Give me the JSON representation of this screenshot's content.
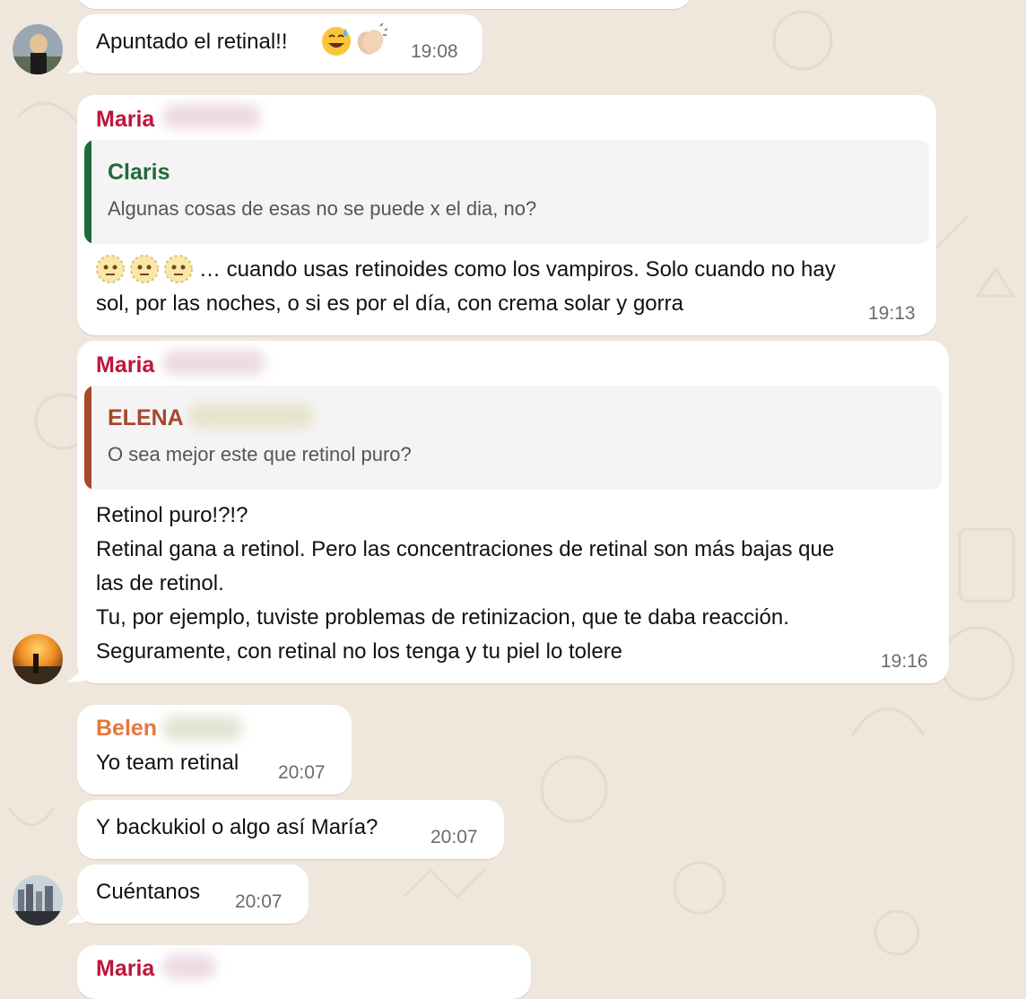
{
  "messages": [
    {
      "text": "Apuntado el retinal!!",
      "time": "19:08",
      "emojis": [
        "grinning-sweat-emoji",
        "clapping-hands-emoji"
      ]
    },
    {
      "sender": "Maria",
      "quote_name": "Claris",
      "quote_text": "Algunas cosas de esas no se puede x el dia, no?",
      "text": "… cuando usas retinoides como los vampiros. Solo cuando no hay\nsol, por las noches, o si es por el día, con crema solar y gorra",
      "time": "19:13"
    },
    {
      "sender": "Maria",
      "quote_name": "ELENA",
      "quote_text": "O sea mejor este que retinol puro?",
      "text": "Retinol puro!?!?\nRetinal gana a retinol. Pero las concentraciones de retinal son más bajas que\nlas de retinol.\nTu, por ejemplo, tuviste problemas de retinizacion, que te daba reacción.\nSeguramente, con retinal no los tenga y tu piel lo tolere",
      "time": "19:16"
    },
    {
      "sender": "Belen",
      "text": "Yo team retinal",
      "time": "20:07"
    },
    {
      "text": "Y backukiol o algo así María?",
      "time": "20:07"
    },
    {
      "text": "Cuéntanos",
      "time": "20:07"
    },
    {
      "sender": "Maria"
    }
  ],
  "colors": {
    "maria": "#c0143c",
    "claris": "#1e6b3a",
    "elena": "#a8472a",
    "belen": "#e8763a",
    "background": "#efe7dc"
  }
}
